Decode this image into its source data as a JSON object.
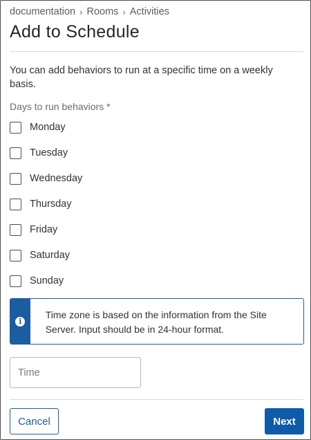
{
  "breadcrumb": [
    {
      "label": "documentation"
    },
    {
      "label": "Rooms"
    },
    {
      "label": "Activities"
    }
  ],
  "breadcrumb_separator": "›",
  "title": "Add to Schedule",
  "intro": "You can add behaviors to run at a specific time on a weekly basis.",
  "days_label": "Days to run behaviors *",
  "days": [
    {
      "label": "Monday",
      "checked": false
    },
    {
      "label": "Tuesday",
      "checked": false
    },
    {
      "label": "Wednesday",
      "checked": false
    },
    {
      "label": "Thursday",
      "checked": false
    },
    {
      "label": "Friday",
      "checked": false
    },
    {
      "label": "Saturday",
      "checked": false
    },
    {
      "label": "Sunday",
      "checked": false
    }
  ],
  "info": {
    "icon": "info-icon",
    "icon_glyph": "i",
    "text": "Time zone is based on the information from the Site Server. Input should be in 24-hour format.",
    "accent_color": "#1b5da1"
  },
  "time_input": {
    "value": "",
    "placeholder": "Time"
  },
  "buttons": {
    "cancel": "Cancel",
    "next": "Next"
  },
  "colors": {
    "primary": "#0e5ba8",
    "border": "#1b5da1"
  }
}
